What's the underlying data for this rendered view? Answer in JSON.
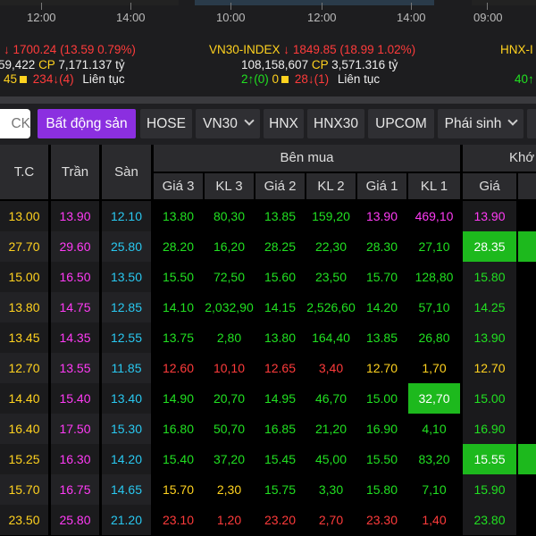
{
  "colors": {
    "ref": "#ffd21f",
    "ceiling": "#ff3bf5",
    "floor": "#29c8f0",
    "up": "#21e021",
    "down": "#ff3b3b",
    "active_tab": "#8b2fe0",
    "highlight": "#1db91d"
  },
  "index_panels": [
    {
      "times": [
        "12:00",
        "14:00"
      ],
      "value_line": "1700.24 (13.59  0.79%)",
      "volume": "59,422",
      "cp_label": "CP",
      "cp_value": "7,171.137 tỷ",
      "adv_ref": "45",
      "decliners": "234",
      "decliners_ceil": "(4)",
      "session": "Liên tục"
    },
    {
      "times": [
        "10:00",
        "12:00",
        "14:00"
      ],
      "name": "VN30-INDEX",
      "value_line": "1849.85 (18.99  1.02%)",
      "volume": "108,158,607",
      "cp_label": "CP",
      "cp_value": "3,571.316 tỷ",
      "advancers": "2",
      "advancers_ceil": "(0)",
      "unchanged": "0",
      "decliners": "28",
      "decliners_ceil": "(1)",
      "session": "Liên tục"
    },
    {
      "times": [
        "09:00"
      ],
      "name": "HNX-I",
      "advancers": "40"
    }
  ],
  "tabs": {
    "search_text": "CK",
    "items": [
      {
        "label": "Bất động sản",
        "active": true
      },
      {
        "label": "HOSE"
      },
      {
        "label": "VN30",
        "dropdown": true
      },
      {
        "label": "HNX"
      },
      {
        "label": "HNX30"
      },
      {
        "label": "UPCOM"
      },
      {
        "label": "Phái sinh",
        "dropdown": true
      }
    ]
  },
  "table": {
    "headers": {
      "tc": "T.C",
      "ceil": "Trần",
      "floor": "Sàn",
      "buy_group": "Bên mua",
      "match_group": "Khớ",
      "buy": [
        "Giá 3",
        "KL 3",
        "Giá 2",
        "KL 2",
        "Giá 1",
        "KL 1"
      ],
      "match_price": "Giá"
    },
    "rows": [
      {
        "tc": "13.00",
        "ceil": "13.90",
        "floor": "12.10",
        "g3": "13.80",
        "k3": "80,30",
        "g2": "13.85",
        "k2": "159,20",
        "g1": "13.90",
        "k1": "469,10",
        "mp": "13.90",
        "cls": [
          "up",
          "up",
          "up",
          "up",
          "ceil",
          "ceil",
          "ceil"
        ],
        "hl": []
      },
      {
        "tc": "27.70",
        "ceil": "29.60",
        "floor": "25.80",
        "g3": "28.20",
        "k3": "16,20",
        "g2": "28.25",
        "k2": "22,30",
        "g1": "28.30",
        "k1": "27,10",
        "mp": "28.35",
        "cls": [
          "up",
          "up",
          "up",
          "up",
          "up",
          "up",
          "up"
        ],
        "hl": [
          "mp"
        ]
      },
      {
        "tc": "15.00",
        "ceil": "16.50",
        "floor": "13.50",
        "g3": "15.50",
        "k3": "72,50",
        "g2": "15.60",
        "k2": "23,50",
        "g1": "15.70",
        "k1": "128,80",
        "mp": "15.80",
        "cls": [
          "up",
          "up",
          "up",
          "up",
          "up",
          "up",
          "up"
        ],
        "hl": []
      },
      {
        "tc": "13.80",
        "ceil": "14.75",
        "floor": "12.85",
        "g3": "14.10",
        "k3": "2,032,90",
        "g2": "14.15",
        "k2": "2,526,60",
        "g1": "14.20",
        "k1": "57,10",
        "mp": "14.25",
        "cls": [
          "up",
          "up",
          "up",
          "up",
          "up",
          "up",
          "up"
        ],
        "hl": []
      },
      {
        "tc": "13.45",
        "ceil": "14.35",
        "floor": "12.55",
        "g3": "13.75",
        "k3": "2,80",
        "g2": "13.80",
        "k2": "164,40",
        "g1": "13.85",
        "k1": "26,80",
        "mp": "13.90",
        "cls": [
          "up",
          "up",
          "up",
          "up",
          "up",
          "up",
          "up"
        ],
        "hl": []
      },
      {
        "tc": "12.70",
        "ceil": "13.55",
        "floor": "11.85",
        "g3": "12.60",
        "k3": "10,10",
        "g2": "12.65",
        "k2": "3,40",
        "g1": "12.70",
        "k1": "1,70",
        "mp": "12.70",
        "cls": [
          "dn",
          "dn",
          "dn",
          "dn",
          "ref",
          "ref",
          "ref"
        ],
        "hl": []
      },
      {
        "tc": "14.40",
        "ceil": "15.40",
        "floor": "13.40",
        "g3": "14.90",
        "k3": "20,70",
        "g2": "14.95",
        "k2": "46,70",
        "g1": "15.00",
        "k1": "32,70",
        "mp": "15.00",
        "cls": [
          "up",
          "up",
          "up",
          "up",
          "up",
          "up",
          "up"
        ],
        "hl": [
          "k1"
        ]
      },
      {
        "tc": "16.40",
        "ceil": "17.50",
        "floor": "15.30",
        "g3": "16.80",
        "k3": "50,70",
        "g2": "16.85",
        "k2": "21,20",
        "g1": "16.90",
        "k1": "4,10",
        "mp": "16.90",
        "cls": [
          "up",
          "up",
          "up",
          "up",
          "up",
          "up",
          "up"
        ],
        "hl": []
      },
      {
        "tc": "15.25",
        "ceil": "16.30",
        "floor": "14.20",
        "g3": "15.40",
        "k3": "37,20",
        "g2": "15.45",
        "k2": "45,00",
        "g1": "15.50",
        "k1": "83,20",
        "mp": "15.55",
        "cls": [
          "up",
          "up",
          "up",
          "up",
          "up",
          "up",
          "up"
        ],
        "hl": [
          "mp"
        ]
      },
      {
        "tc": "15.70",
        "ceil": "16.75",
        "floor": "14.65",
        "g3": "15.70",
        "k3": "2,30",
        "g2": "15.75",
        "k2": "3,30",
        "g1": "15.80",
        "k1": "7,10",
        "mp": "15.90",
        "cls": [
          "ref",
          "ref",
          "up",
          "up",
          "up",
          "up",
          "up"
        ],
        "hl": []
      },
      {
        "tc": "23.50",
        "ceil": "25.80",
        "floor": "21.20",
        "g3": "23.10",
        "k3": "1,20",
        "g2": "23.20",
        "k2": "2,70",
        "g1": "23.30",
        "k1": "1,40",
        "mp": "23.80",
        "cls": [
          "dn",
          "dn",
          "dn",
          "dn",
          "dn",
          "dn",
          "up"
        ],
        "hl": []
      }
    ]
  }
}
